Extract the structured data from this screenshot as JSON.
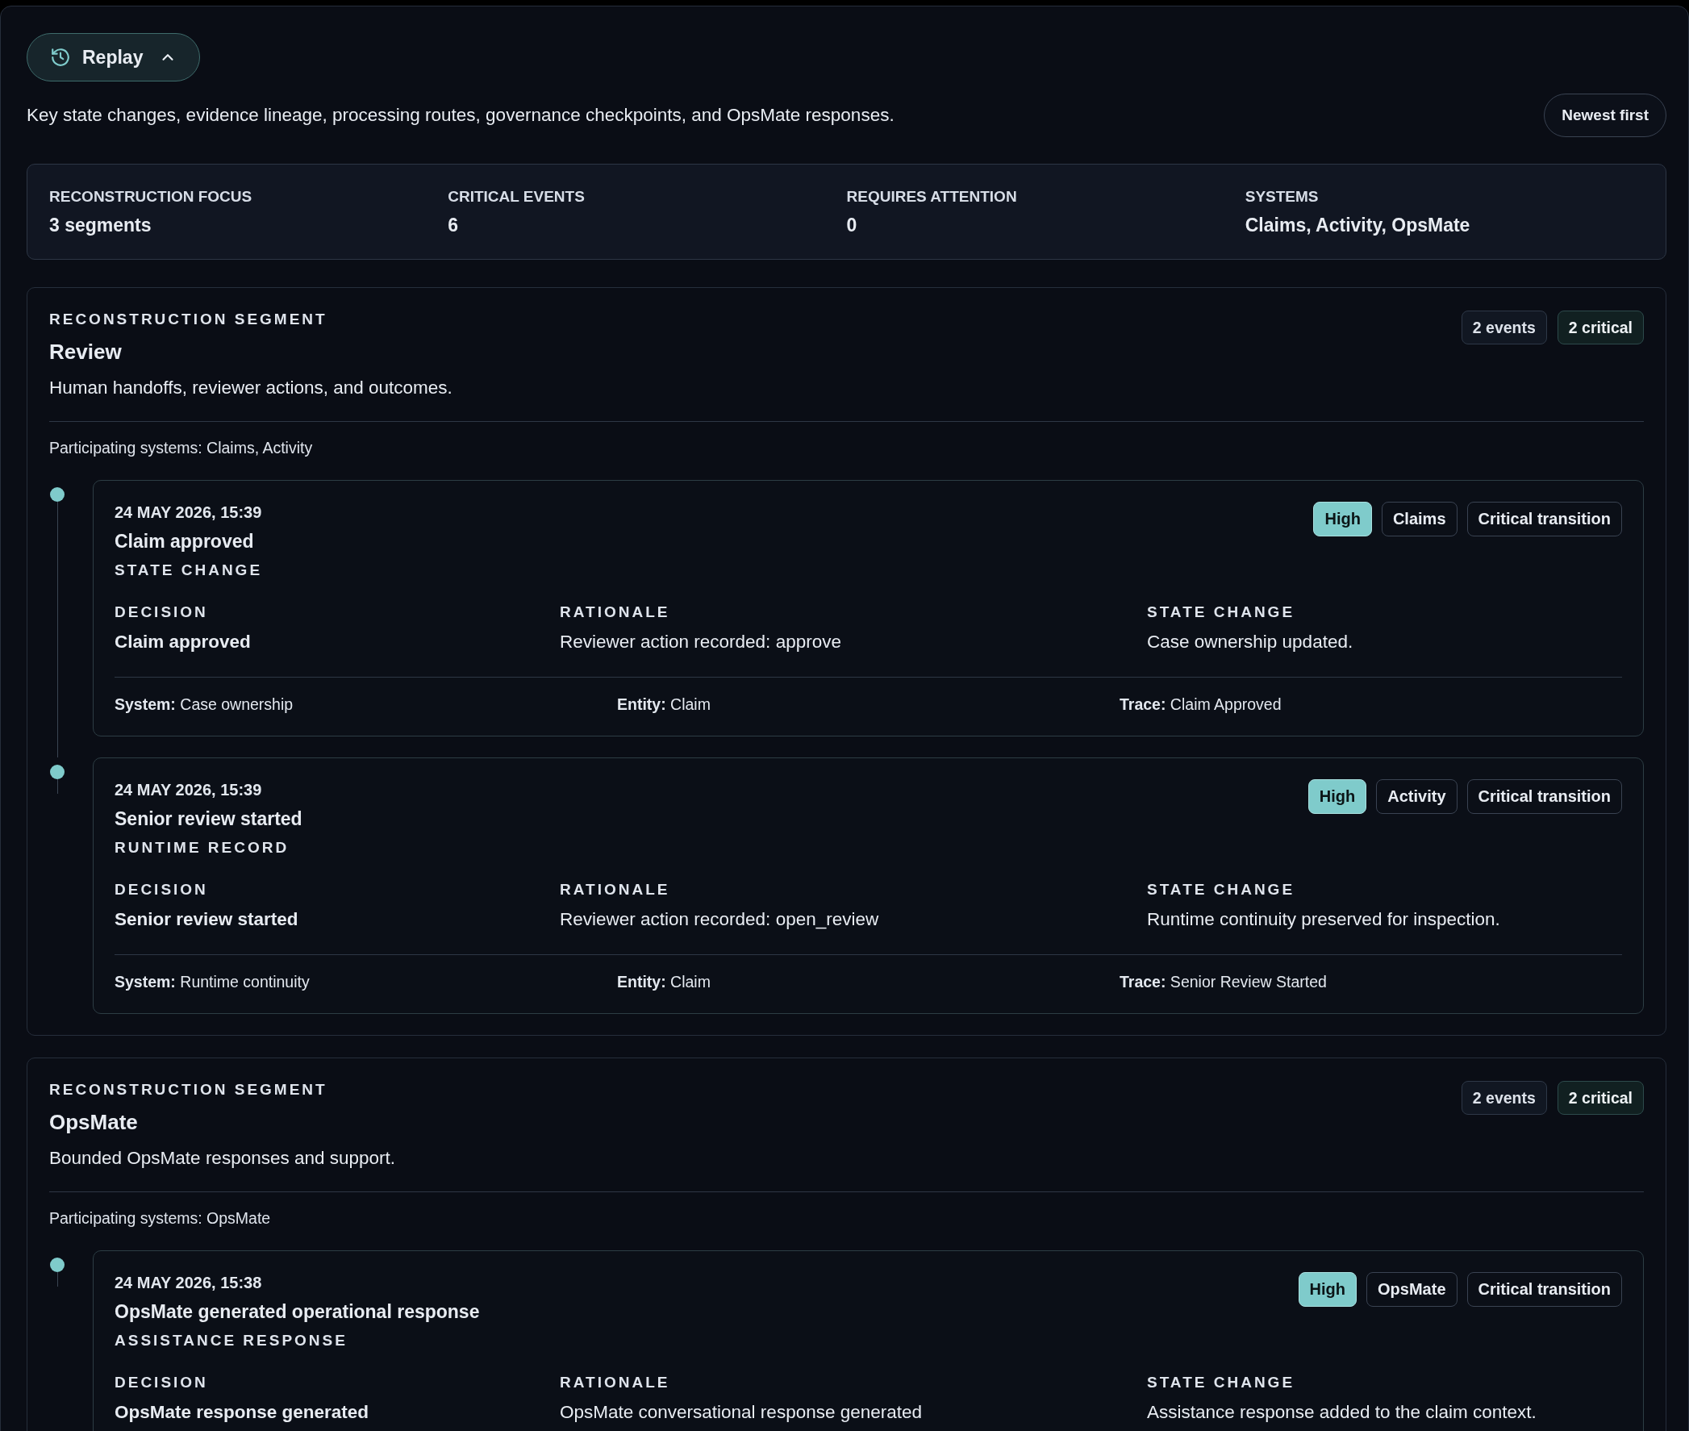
{
  "replay_button": {
    "label": "Replay",
    "expanded": true
  },
  "description": "Key state changes, evidence lineage, processing routes, governance checkpoints, and OpsMate responses.",
  "sort_button": {
    "label": "Newest first"
  },
  "summary": [
    {
      "label": "RECONSTRUCTION FOCUS",
      "value": "3 segments"
    },
    {
      "label": "CRITICAL EVENTS",
      "value": "6"
    },
    {
      "label": "REQUIRES ATTENTION",
      "value": "0"
    },
    {
      "label": "SYSTEMS",
      "value": "Claims, Activity, OpsMate"
    }
  ],
  "segments": [
    {
      "eyebrow": "RECONSTRUCTION SEGMENT",
      "title": "Review",
      "description": "Human handoffs, reviewer actions, and outcomes.",
      "badges": [
        {
          "label": "2 events",
          "kind": "count"
        },
        {
          "label": "2 critical",
          "kind": "critical"
        }
      ],
      "participating": "Participating systems: Claims, Activity",
      "events": [
        {
          "timestamp": "24 MAY 2026, 15:39",
          "title": "Claim approved",
          "type": "STATE CHANGE",
          "tags": [
            {
              "label": "High",
              "kind": "severity"
            },
            {
              "label": "Claims",
              "kind": "system"
            },
            {
              "label": "Critical transition",
              "kind": "flag"
            }
          ],
          "fields": [
            {
              "label": "DECISION",
              "value": "Claim approved",
              "kind": "decision"
            },
            {
              "label": "RATIONALE",
              "value": "Reviewer action recorded: approve",
              "kind": "text"
            },
            {
              "label": "STATE CHANGE",
              "value": "Case ownership updated.",
              "kind": "text"
            }
          ],
          "meta": [
            "**System:** Case ownership",
            "**Entity:** Claim",
            "**Trace:** Claim Approved"
          ]
        },
        {
          "timestamp": "24 MAY 2026, 15:39",
          "title": "Senior review started",
          "type": "RUNTIME RECORD",
          "tags": [
            {
              "label": "High",
              "kind": "severity"
            },
            {
              "label": "Activity",
              "kind": "system"
            },
            {
              "label": "Critical transition",
              "kind": "flag"
            }
          ],
          "fields": [
            {
              "label": "DECISION",
              "value": "Senior review started",
              "kind": "decision"
            },
            {
              "label": "RATIONALE",
              "value": "Reviewer action recorded: open_review",
              "kind": "text"
            },
            {
              "label": "STATE CHANGE",
              "value": "Runtime continuity preserved for inspection.",
              "kind": "text"
            }
          ],
          "meta": [
            "**System:** Runtime continuity",
            "**Entity:** Claim",
            "**Trace:** Senior Review Started"
          ]
        }
      ]
    },
    {
      "eyebrow": "RECONSTRUCTION SEGMENT",
      "title": "OpsMate",
      "description": "Bounded OpsMate responses and support.",
      "badges": [
        {
          "label": "2 events",
          "kind": "count"
        },
        {
          "label": "2 critical",
          "kind": "critical"
        }
      ],
      "participating": "Participating systems: OpsMate",
      "events": [
        {
          "timestamp": "24 MAY 2026, 15:38",
          "title": "OpsMate generated operational response",
          "type": "ASSISTANCE RESPONSE",
          "tags": [
            {
              "label": "High",
              "kind": "severity"
            },
            {
              "label": "OpsMate",
              "kind": "system"
            },
            {
              "label": "Critical transition",
              "kind": "flag"
            }
          ],
          "fields": [
            {
              "label": "DECISION",
              "value": "OpsMate response generated",
              "kind": "decision"
            },
            {
              "label": "RATIONALE",
              "value": "OpsMate conversational response generated",
              "kind": "text"
            },
            {
              "label": "STATE CHANGE",
              "value": "Assistance response added to the claim context.",
              "kind": "text"
            }
          ]
        }
      ]
    }
  ]
}
